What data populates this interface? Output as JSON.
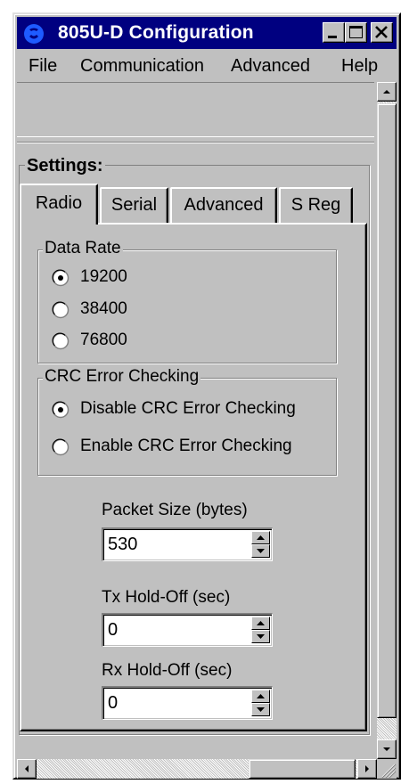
{
  "window": {
    "title": "805U-D Configuration",
    "icon": "app-logo-icon",
    "controls": [
      "minimize-icon",
      "maximize-icon",
      "close-icon"
    ],
    "colors": {
      "titlebar": "#000080",
      "face": "#c0c0c0"
    }
  },
  "menu": {
    "file": "File",
    "communication": "Communication",
    "advanced": "Advanced",
    "help": "Help"
  },
  "settings": {
    "caption": "Settings:",
    "tabs": [
      {
        "label": "Radio",
        "selected": true
      },
      {
        "label": "Serial",
        "selected": false
      },
      {
        "label": "Advanced",
        "selected": false
      },
      {
        "label": "S Reg",
        "selected": false
      }
    ]
  },
  "radio": {
    "data_rate": {
      "caption": "Data Rate",
      "options": [
        {
          "label": "19200",
          "selected": true
        },
        {
          "label": "38400",
          "selected": false
        },
        {
          "label": "76800",
          "selected": false
        }
      ]
    },
    "crc": {
      "caption": "CRC Error Checking",
      "options": [
        {
          "label": "Disable CRC Error Checking",
          "selected": true
        },
        {
          "label": "Enable CRC Error Checking",
          "selected": false
        }
      ]
    },
    "packet_size": {
      "label": "Packet Size (bytes)",
      "value": "530"
    },
    "tx_holdoff": {
      "label": "Tx Hold-Off (sec)",
      "value": "0"
    },
    "rx_holdoff": {
      "label": "Rx Hold-Off (sec)",
      "value": "0"
    }
  }
}
